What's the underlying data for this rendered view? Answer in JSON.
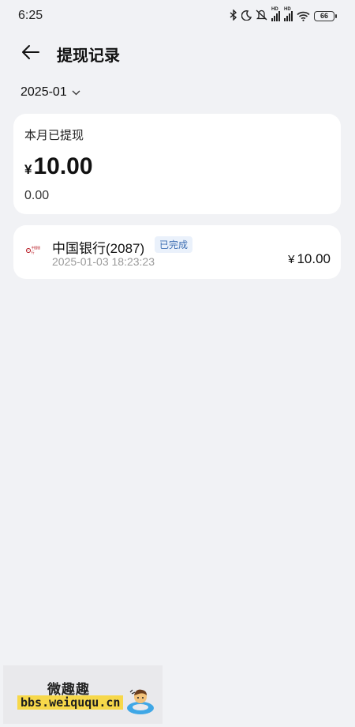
{
  "status_bar": {
    "time": "6:25",
    "battery": "66",
    "icons": [
      "bluetooth-icon",
      "moon-icon",
      "mute-icon",
      "signal-hd-icon",
      "signal-hd-icon",
      "wifi-icon",
      "battery-icon"
    ]
  },
  "header": {
    "title": "提现记录",
    "back_icon": "arrow-left-icon"
  },
  "month_selector": {
    "value": "2025-01",
    "icon": "chevron-down-icon"
  },
  "summary": {
    "label": "本月已提现",
    "currency": "¥",
    "amount": "10.00",
    "sub_amount": "0.00"
  },
  "records": [
    {
      "bank": "中国银行(2087)",
      "status": "已完成",
      "time": "2025-01-03 18:23:23",
      "currency": "¥",
      "amount": "10.00",
      "logo_text": "中国银行"
    }
  ],
  "watermark": {
    "title": "微趣趣",
    "url": "bbs.weiququ.cn"
  },
  "colors": {
    "background": "#f1f2f5",
    "card": "#ffffff",
    "badge_bg": "#eaf1fb",
    "badge_text": "#3e6fb3",
    "bank_red": "#b5121b"
  }
}
